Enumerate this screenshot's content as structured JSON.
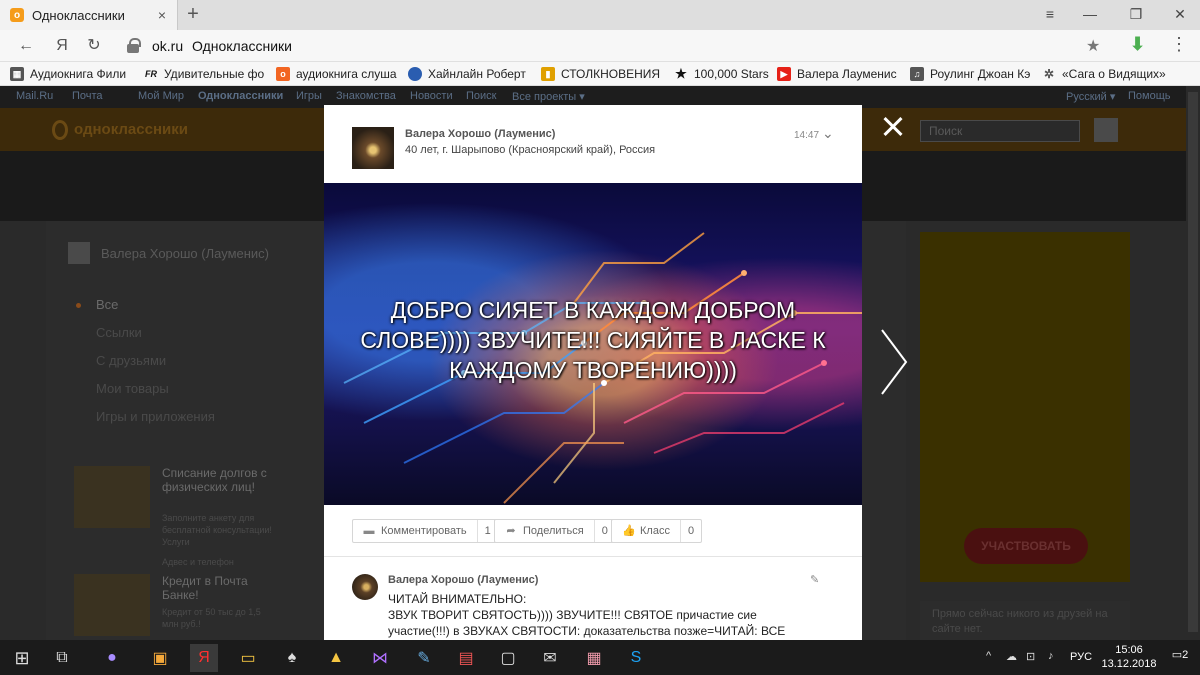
{
  "browser": {
    "tab_title": "Одноклассники",
    "tab_close": "×",
    "new_tab": "+",
    "url_domain": "ok.ru",
    "url_title": "Одноклассники",
    "window_controls": [
      "≡",
      "—",
      "❐",
      "✕"
    ],
    "nav": {
      "back": "←",
      "yandex": "Я",
      "reload": "↻"
    },
    "bookmarks": [
      {
        "label": "Аудиокнига Фили",
        "icon": "audiobook-icon",
        "color": "#444"
      },
      {
        "label": "Удивительные фо",
        "icon": "fr-icon",
        "color": "#222"
      },
      {
        "label": "аудиокнига слуша",
        "icon": "ok-icon",
        "color": "#f26522"
      },
      {
        "label": "Хайнлайн Роберт",
        "icon": "globe-icon",
        "color": "#2a5db0"
      },
      {
        "label": "СТОЛКНОВЕНИЯ /",
        "icon": "bars-icon",
        "color": "#e0a000"
      },
      {
        "label": "100,000 Stars",
        "icon": "star-icon",
        "color": "#111"
      },
      {
        "label": "Валера Лауменис",
        "icon": "youtube-icon",
        "color": "#e62117"
      },
      {
        "label": "Роулинг Джоан Кэ",
        "icon": "bookmark-icon",
        "color": "#555"
      },
      {
        "label": "«Сага о Видящих»",
        "icon": "spider-icon",
        "color": "#555"
      }
    ]
  },
  "ok_page": {
    "topnav": [
      "Mail.Ru",
      "Почта",
      "Мой Мир",
      "Одноклассники",
      "Игры",
      "Знакомства",
      "Новости",
      "Поиск",
      "Все проекты ▾"
    ],
    "topnav_right": [
      "Русский ▾",
      "Помощь"
    ],
    "logo": "одноклассники",
    "search_placeholder": "Поиск",
    "profile_name": "Валера Хорошо (Лауменис)",
    "menu": [
      "Все",
      "Ссылки",
      "С друзьями",
      "Мои товары",
      "Игры и приложения"
    ],
    "ads": [
      {
        "title": "Списание долгов с физических лиц!",
        "text": "Заполните анкету для бесплатной консультации! Услуги"
      },
      {
        "title": "Кредит в Почта Банке!",
        "text": "Кредит от 50 тыс до 1,5 млн руб.!"
      }
    ],
    "ads_label": "Адвес и телефон",
    "right_button": "УЧАСТВОВАТЬ",
    "friends_text": "Прямо сейчас никого из друзей на сайте нет."
  },
  "modal": {
    "author": "Валера Хорошо (Лауменис)",
    "info": "40 лет, г. Шарыпово (Красноярский край), Россия",
    "time": "14:47",
    "chevron": "⌄",
    "caption": "ДОБРО СИЯЕТ В КАЖДОМ ДОБРОМ СЛОВЕ)))) ЗВУЧИТЕ!!! СИЯЙТЕ В ЛАСКЕ К КАЖДОМУ ТВОРЕНИЮ))))",
    "actions": [
      {
        "label": "Комментировать",
        "count": "1",
        "icon": "comment-icon"
      },
      {
        "label": "Поделиться",
        "count": "0",
        "icon": "share-icon"
      },
      {
        "label": "Класс",
        "count": "0",
        "icon": "like-icon"
      }
    ],
    "comment": {
      "author": "Валера Хорошо (Лауменис)",
      "edit": "✎",
      "lines": [
        "ЧИТАЙ ВНИМАТЕЛЬНО:",
        "ЗВУК ТВОРИТ СВЯТОСТЬ)))) ЗВУЧИТЕ!!! СВЯТОЕ причастие сие",
        "участие(!!!) в ЗВУКАХ СВЯТОСТИ: доказательства позже=ЧИТАЙ: ВСЕ"
      ]
    }
  },
  "taskbar": {
    "lang": "РУС",
    "time": "15:06",
    "date": "13.12.2018",
    "notifications": "2",
    "tray_icons": [
      "^",
      "☁",
      "⊡",
      "♪"
    ]
  }
}
